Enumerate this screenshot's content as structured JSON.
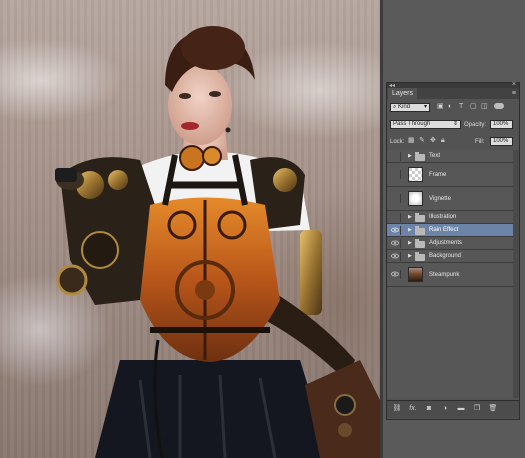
{
  "panel": {
    "title": "Layers",
    "menu_icon": "panel-menu-icon",
    "filter": {
      "kind": "Kind"
    },
    "blend_mode": "Pass Through",
    "opacity": {
      "label": "Opacity:",
      "value": "100%"
    },
    "lock": {
      "label": "Lock:"
    },
    "fill": {
      "label": "Fill:",
      "value": "100%"
    },
    "layers": [
      {
        "name": "Text",
        "type": "group",
        "visible": false,
        "selected": false
      },
      {
        "name": "Frame",
        "type": "layer",
        "visible": false,
        "selected": false,
        "thumb": "transparent"
      },
      {
        "name": "Vignette",
        "type": "layer",
        "visible": false,
        "selected": false,
        "thumb": "white-blur"
      },
      {
        "name": "Illustration",
        "type": "group",
        "visible": false,
        "selected": false
      },
      {
        "name": "Rain Effect",
        "type": "group",
        "visible": true,
        "selected": true
      },
      {
        "name": "Adjustments",
        "type": "group",
        "visible": true,
        "selected": false
      },
      {
        "name": "Background",
        "type": "group",
        "visible": true,
        "selected": false
      },
      {
        "name": "Steampunk",
        "type": "layer",
        "visible": true,
        "selected": false,
        "thumb": "photo"
      }
    ],
    "bottom_icons": [
      "link-icon",
      "fx-icon",
      "mask-icon",
      "adjustment-icon",
      "group-icon",
      "new-layer-icon",
      "trash-icon"
    ],
    "fx_label": "fx."
  },
  "colors": {
    "panel_bg": "#535353",
    "selected_row": "#6b84a8",
    "corset_orange": "#c26a1e",
    "brass": "#b08a3c"
  }
}
